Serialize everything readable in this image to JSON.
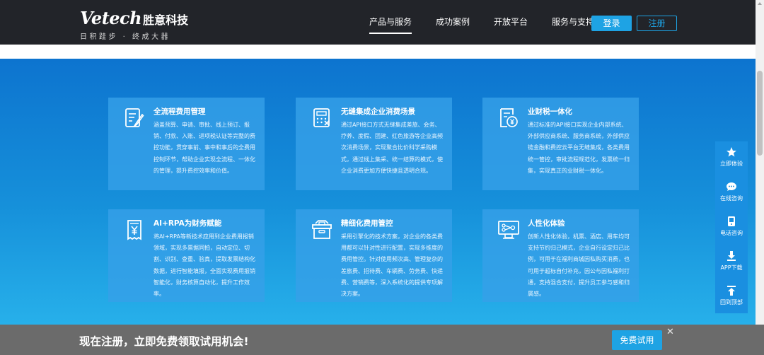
{
  "header": {
    "logo_brand": "Vetech",
    "logo_cn": "胜意科技",
    "logo_slogan": "日积跬步 · 终成大器",
    "nav": [
      {
        "label": "产品与服务",
        "active": true
      },
      {
        "label": "成功案例",
        "active": false
      },
      {
        "label": "开放平台",
        "active": false
      },
      {
        "label": "服务与支持",
        "active": false
      }
    ],
    "login_label": "登录",
    "register_label": "注册"
  },
  "cards": [
    {
      "title": "全流程费用管理",
      "icon": "form-edit-icon",
      "text": "涵盖预算、申请、审批、线上预订、报销、付款、入账、进项税认证等完整的费控功能，贯穿事前、事中和事后的全费用控制环节，帮助企业实现全流程、一体化的管理，提升费控效率和价值。"
    },
    {
      "title": "无缝集成企业消费场景",
      "icon": "calculator-icon",
      "text": "通过API接口方式无缝集成差旅、会务、疗养、度假、团建、红色旅游等企业高频次消费场景，实现聚合比价科学采购模式，通过线上集采、统一结算的模式，使企业消费更加方便快捷且透明合规。"
    },
    {
      "title": "业财税一体化",
      "icon": "invoice-yen-icon",
      "text": "通过标准的API接口实现企业内部系统、外部供应商系统、服务商系统，外部供应链金融和费控云平台无缝集成，各类费用统一管控，审批流程规范化，发票统一归集，实现真正的业财税一体化。"
    },
    {
      "title": "AI+RPA为财务赋能",
      "icon": "receipt-yen-icon",
      "text": "将AI+RPA等新技术应用到企业费用报销领域，实现多票据同拍，自动定位、切割、识别、查重、验真，提取发票结构化数据，进行智能填报，全面实现费用报销智能化，财务核算自动化，提升工作效率。"
    },
    {
      "title": "精细化费用管控",
      "icon": "archive-box-icon",
      "text": "采用引擎化的技术方案，对企业的各类费用都可以针对性进行配置，实现多维度的费用管控。针对使用频次高、管理复杂的差旅费、招待费、车辆费、劳务费、快递费、营销费等，深入系统化的提供专项解决方案。"
    },
    {
      "title": "人性化体验",
      "icon": "network-screen-icon",
      "text": "创新人性化体验，机票、酒店、用车均可支持节约归己模式，企业自行设定归己比例，可用于在福利商城因私购买消费，也可用于超标自付补充，因公与因私福利打通，支持混合支付，提升员工参与感和归属感。"
    }
  ],
  "side_bar": [
    {
      "label": "立即体验",
      "icon": "star-icon"
    },
    {
      "label": "在线咨询",
      "icon": "chat-bubble-icon"
    },
    {
      "label": "电话咨询",
      "icon": "phone-icon"
    },
    {
      "label": "APP下载",
      "icon": "download-icon"
    },
    {
      "label": "回到顶部",
      "icon": "back-to-top-icon"
    }
  ],
  "bottom_banner": {
    "text": "现在注册，立即免费领取试用机会!",
    "button_label": "免费试用",
    "close_label": "✕"
  },
  "colors": {
    "header_bg": "#222429",
    "accent": "#1ea3e4",
    "main_top": "#0d74cf",
    "main_bottom": "#27b0ea",
    "card_bg": "#36a0e8",
    "banner_bg": "#6b6b6b"
  }
}
